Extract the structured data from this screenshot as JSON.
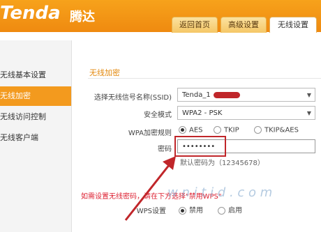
{
  "brand": {
    "logo": "Tenda",
    "logo_cn": "腾达"
  },
  "tabs": [
    {
      "label": "返回首页",
      "active": false
    },
    {
      "label": "高级设置",
      "active": false
    },
    {
      "label": "无线设置",
      "active": true
    }
  ],
  "sidebar": {
    "items": [
      {
        "label": "无线基本设置",
        "active": false
      },
      {
        "label": "无线加密",
        "active": true
      },
      {
        "label": "无线访问控制",
        "active": false
      },
      {
        "label": "无线客户端",
        "active": false
      }
    ]
  },
  "section_title": "无线加密",
  "form": {
    "ssid_label": "选择无线信号名称(SSID)",
    "ssid_value": "Tenda_1",
    "mode_label": "安全模式",
    "mode_value": "WPA2 - PSK",
    "cipher_label": "WPA加密规则",
    "cipher_options": [
      "AES",
      "TKIP",
      "TKIP&AES"
    ],
    "cipher_selected": "AES",
    "password_label": "密码",
    "password_value": "••••••••",
    "password_hint": "默认密码为（12345678）",
    "wps_note": "如需设置无线密码，请在下方选择\"禁用WPS\"",
    "wps_label": "WPS设置",
    "wps_options": [
      "禁用",
      "启用"
    ],
    "wps_selected": "禁用"
  },
  "watermark": "w n i t i d . c o m",
  "colors": {
    "brand_orange": "#f39a1e",
    "annotation_red": "#c0262a"
  }
}
